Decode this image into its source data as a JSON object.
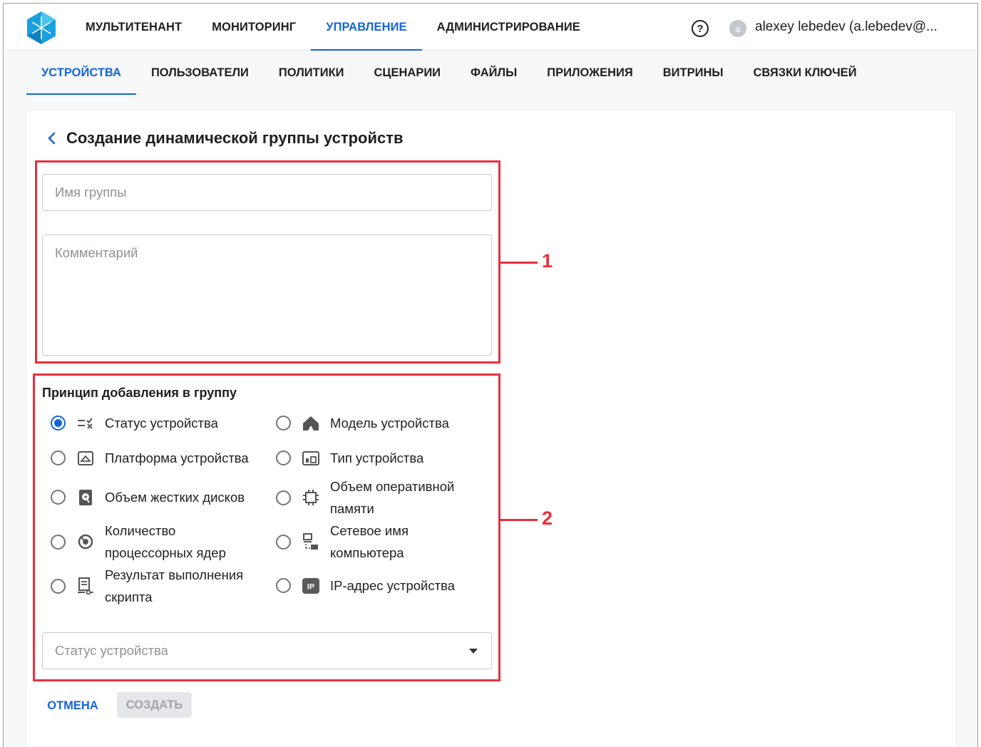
{
  "topnav": {
    "items": [
      {
        "label": "МУЛЬТИТЕНАНТ"
      },
      {
        "label": "МОНИТОРИНГ"
      },
      {
        "label": "УПРАВЛЕНИЕ",
        "active": true
      },
      {
        "label": "АДМИНИСТРИРОВАНИЕ"
      }
    ],
    "help_icon": "question-circle-icon",
    "avatar_initial": "a",
    "username": "alexey lebedev (a.lebedev@..."
  },
  "subnav": {
    "items": [
      {
        "label": "УСТРОЙСТВА",
        "active": true
      },
      {
        "label": "ПОЛЬЗОВАТЕЛИ"
      },
      {
        "label": "ПОЛИТИКИ"
      },
      {
        "label": "СЦЕНАРИИ"
      },
      {
        "label": "ФАЙЛЫ"
      },
      {
        "label": "ПРИЛОЖЕНИЯ"
      },
      {
        "label": "ВИТРИНЫ"
      },
      {
        "label": "СВЯЗКИ КЛЮЧЕЙ"
      }
    ]
  },
  "page": {
    "title": "Создание динамической группы устройств",
    "group_name": {
      "value": "",
      "placeholder": "Имя группы"
    },
    "comment": {
      "value": "",
      "placeholder": "Комментарий"
    },
    "principle_title": "Принцип добавления в группу",
    "options": [
      {
        "label": "Статус устройства",
        "icon": "status-list-icon",
        "checked": true
      },
      {
        "label": "Модель устройства",
        "icon": "house-icon",
        "checked": false
      },
      {
        "label": "Платформа устройства",
        "icon": "platform-icon",
        "checked": false
      },
      {
        "label": "Тип устройства",
        "icon": "device-type-icon",
        "checked": false
      },
      {
        "label": "Объем жестких дисков",
        "icon": "hard-disk-icon",
        "checked": false
      },
      {
        "label": "Объем оперативной памяти",
        "icon": "memory-chip-icon",
        "checked": false
      },
      {
        "label": "Количество процессорных ядер",
        "icon": "processor-icon",
        "checked": false
      },
      {
        "label": "Сетевое имя компьютера",
        "icon": "network-computer-icon",
        "checked": false
      },
      {
        "label": "Результат выполнения скрипта",
        "icon": "script-icon",
        "checked": false
      },
      {
        "label": "IP-адрес устройства",
        "icon": "ip-badge-icon",
        "checked": false
      }
    ],
    "select": {
      "placeholder": "Статус устройства",
      "value": ""
    },
    "cancel_label": "ОТМЕНА",
    "create_label": "СОЗДАТЬ"
  },
  "annotations": {
    "first": "1",
    "second": "2"
  },
  "colors": {
    "accent": "#1565d8",
    "annotation": "#e8303d",
    "logo": "#1aa0e0"
  }
}
